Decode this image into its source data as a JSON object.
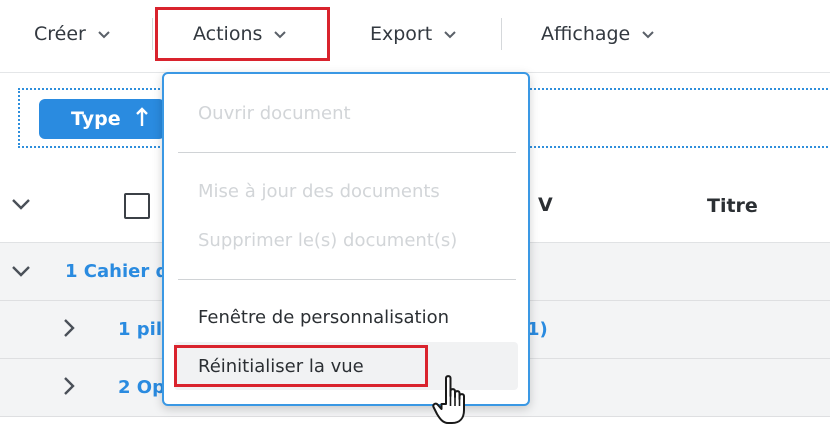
{
  "toolbar": {
    "creer": "Créer",
    "actions": "Actions",
    "export": "Export",
    "affichage": "Affichage"
  },
  "group_chip": {
    "label": "Type",
    "sort_icon": "arrow-up-icon"
  },
  "grid": {
    "columns": {
      "v": "V",
      "titre": "Titre"
    },
    "rows": [
      {
        "label": "1 Cahier d",
        "level": 0,
        "suffix": ""
      },
      {
        "label": "1 pil",
        "level": 1,
        "suffix": "1)"
      },
      {
        "label": "2 Op",
        "level": 1,
        "suffix": ""
      }
    ]
  },
  "actions_menu": {
    "items": [
      {
        "label": "Ouvrir document",
        "enabled": false
      },
      {
        "label": "Mise à jour des documents",
        "enabled": false
      },
      {
        "label": "Supprimer le(s) document(s)",
        "enabled": false
      },
      {
        "label": "Fenêtre de personnalisation",
        "enabled": true
      },
      {
        "label": "Réinitialiser la vue",
        "enabled": true,
        "hovered": true
      }
    ]
  },
  "colors": {
    "accent": "#2a8be0",
    "highlight_box": "#d9232d",
    "menu_border": "#3a98e4"
  }
}
